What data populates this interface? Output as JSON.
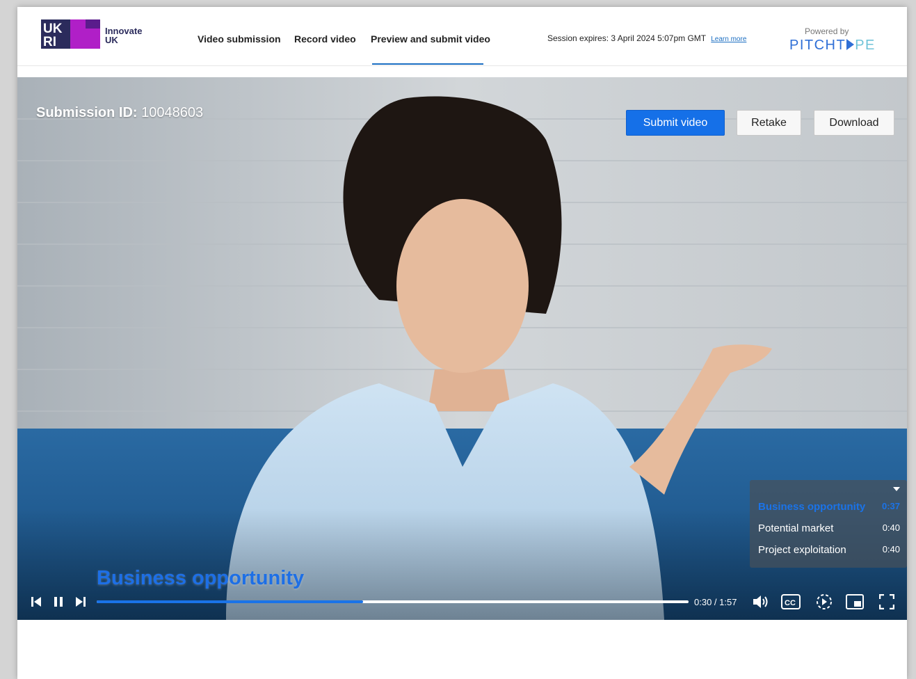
{
  "header": {
    "logo_text_line1": "Innovate",
    "logo_text_line2": "UK",
    "nav": [
      {
        "label": "Video submission"
      },
      {
        "label": "Record video"
      },
      {
        "label": "Preview and submit video"
      }
    ],
    "active_nav": "Preview and submit video",
    "session_text": "Session expires: 3 April 2024 5:07pm GMT",
    "learn_more": "Learn more",
    "powered_by": "Powered by",
    "pitchtape_a": "PITCHT",
    "pitchtape_b": "PE"
  },
  "video": {
    "submission_label": "Submission ID:",
    "submission_id": "10048603",
    "submit_label": "Submit video",
    "retake_label": "Retake",
    "download_label": "Download",
    "current_chapter": "Business opportunity",
    "current_time": "0:30",
    "duration": "1:57",
    "time_sep": " / ",
    "progress_fraction": 0.45,
    "chapters": [
      {
        "title": "Business opportunity",
        "time": "0:37",
        "active": true
      },
      {
        "title": "Potential market",
        "time": "0:40",
        "active": false
      },
      {
        "title": "Project exploitation",
        "time": "0:40",
        "active": false
      }
    ]
  },
  "colors": {
    "accent": "#1570e8",
    "brand_purple": "#b01fc7",
    "brand_navy": "#2b2b5c"
  }
}
